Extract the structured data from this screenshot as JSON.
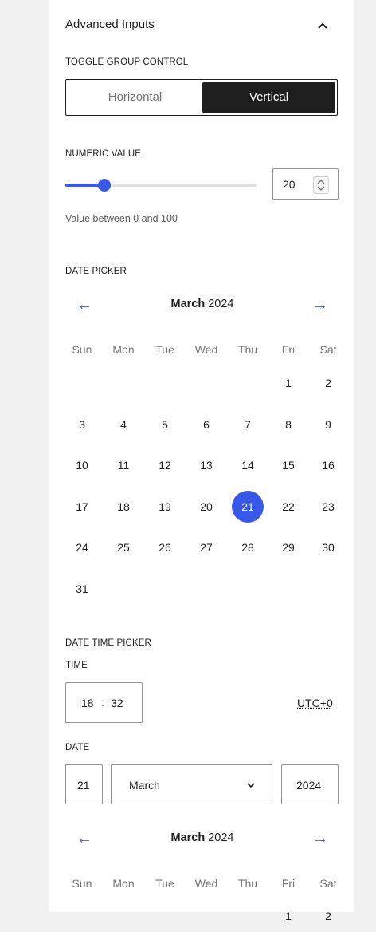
{
  "section": {
    "title": "Advanced Inputs"
  },
  "toggle": {
    "label": "TOGGLE GROUP CONTROL",
    "options": [
      "Horizontal",
      "Vertical"
    ],
    "selected": "Vertical"
  },
  "numeric": {
    "label": "NUMERIC VALUE",
    "value": "20",
    "help": "Value between 0 and 100",
    "min": 0,
    "max": 100
  },
  "datepicker": {
    "label": "DATE PICKER",
    "month": "March",
    "year": "2024",
    "weekdays": [
      "Sun",
      "Mon",
      "Tue",
      "Wed",
      "Thu",
      "Fri",
      "Sat"
    ],
    "selected_day": "21",
    "first_weekday_index": 5,
    "days": [
      "1",
      "2",
      "3",
      "4",
      "5",
      "6",
      "7",
      "8",
      "9",
      "10",
      "11",
      "12",
      "13",
      "14",
      "15",
      "16",
      "17",
      "18",
      "19",
      "20",
      "21",
      "22",
      "23",
      "24",
      "25",
      "26",
      "27",
      "28",
      "29",
      "30",
      "31"
    ]
  },
  "datetime": {
    "label": "DATE TIME PICKER",
    "time_label": "TIME",
    "hours": "18",
    "separator": ":",
    "minutes": "32",
    "timezone": "UTC+0",
    "date_label": "DATE",
    "day": "21",
    "month": "March",
    "year": "2024",
    "calendar": {
      "month": "March",
      "year": "2024"
    }
  },
  "colors": {
    "accent": "#3858e9",
    "dark": "#1e1e1e"
  },
  "icons": {
    "collapse": "chevron-up-icon",
    "prev": "arrow-left-icon",
    "next": "arrow-right-icon",
    "select": "chevron-down-icon",
    "spinner": "spinner-arrows-icon"
  }
}
